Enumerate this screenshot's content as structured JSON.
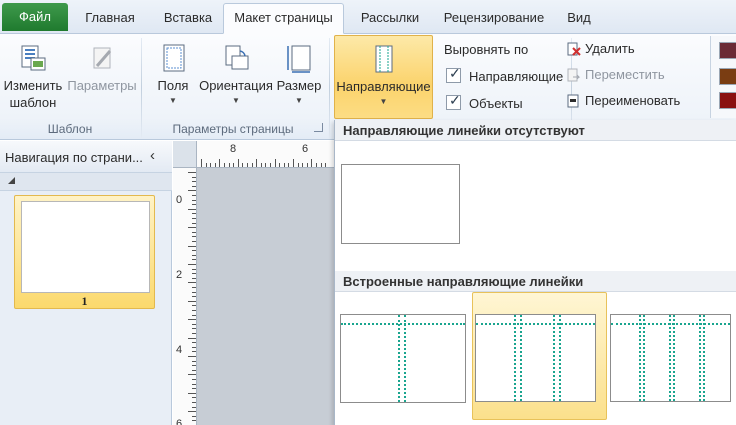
{
  "tabs": [
    {
      "label": "Файл"
    },
    {
      "label": "Главная"
    },
    {
      "label": "Вставка"
    },
    {
      "label": "Макет страницы"
    },
    {
      "label": "Рассылки"
    },
    {
      "label": "Рецензирование"
    },
    {
      "label": "Вид"
    }
  ],
  "ribbon": {
    "change_template": {
      "line1": "Изменить",
      "line2": "шаблон"
    },
    "parameters": "Параметры",
    "group_template": "Шаблон",
    "margins": "Поля",
    "orientation": "Ориентация",
    "size": "Размер",
    "group_page_params": "Параметры страницы",
    "guides": "Направляющие",
    "align_to": "Выровнять по",
    "chk_guides": "Направляющие",
    "chk_objects": "Объекты",
    "delete": "Удалить",
    "move": "Переместить",
    "rename": "Переименовать",
    "swatch_colors": [
      "#6b2b36",
      "#7a3d12",
      "#8a1010"
    ]
  },
  "nav": {
    "title": "Навигация по страни...",
    "page_number": "1"
  },
  "rulers": {
    "h_numbers": [
      "8",
      "6"
    ],
    "v_numbers": [
      "0",
      "2",
      "4",
      "6"
    ]
  },
  "dropdown": {
    "section_none": "Направляющие линейки отсутствуют",
    "section_builtin": "Встроенные направляющие линейки"
  },
  "colors": {
    "file_tab": "#2e8b3d",
    "hover": "#fbd36c",
    "guide_line": "#1aa58f"
  }
}
